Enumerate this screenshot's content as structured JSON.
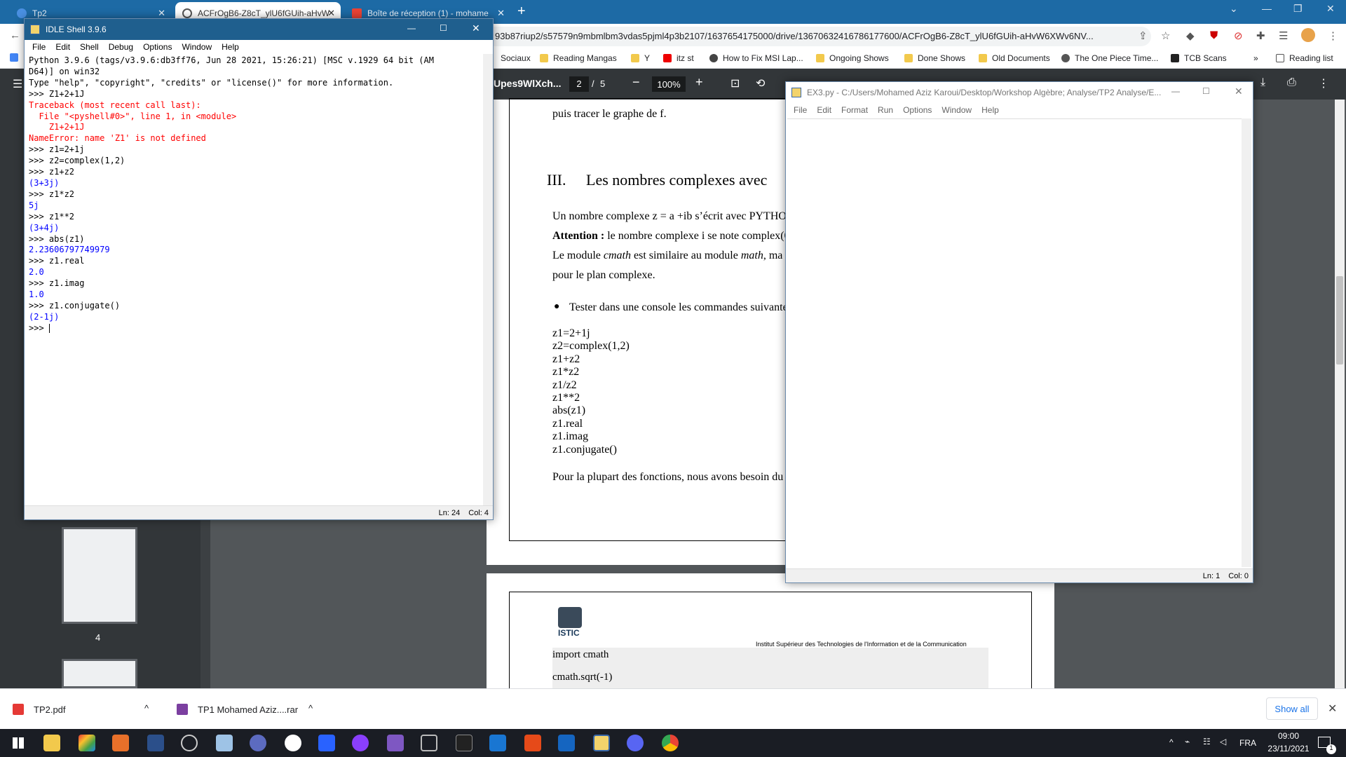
{
  "browser": {
    "tabs": [
      {
        "title": "Tp2"
      },
      {
        "title": "ACFrOgB6-Z8cT_ylU6fGUih-aHvW"
      },
      {
        "title": "Boîte de réception (1) - mohame"
      }
    ],
    "url": "93b87riup2/s57579n9mbmlbm3vdas5pjml4p3b2107/1637654175000/drive/13670632416786177600/ACFrOgB6-Z8cT_ylU6fGUih-aHvW6XWv6NV...",
    "bookmarks": [
      "Sociaux",
      "Reading Mangas",
      "Y",
      "itz st",
      "How to Fix MSI Lap...",
      "Ongoing Shows",
      "Done Shows",
      "Old Documents",
      "The One Piece Time...",
      "TCB Scans"
    ],
    "reading_list": "Reading list"
  },
  "pdf": {
    "title": "Upes9WlXch...",
    "page_current": "2",
    "page_sep": "/",
    "page_total": "5",
    "zoom": "100%",
    "thumb_number": "4",
    "text_top": "puis tracer le graphe de f.",
    "heading_num": "III.",
    "heading": "Les nombres complexes avec",
    "p1": "Un nombre complexe z = a +ib s’écrit avec PYTHO",
    "p2_bold": "Attention :",
    "p2": "le nombre complexe i se note complex(0",
    "p3a": "Le module ",
    "p3b": "cmath",
    "p3c": " est similaire au module ",
    "p3d": "math",
    "p3e": ", ma",
    "p4": "pour le plan complexe.",
    "bullet": "Tester dans une console les commandes suivante",
    "code": [
      "z1=2+1j",
      "z2=complex(1,2)",
      "z1+z2",
      "z1*z2",
      "z1/z2",
      "z1**2",
      "abs(z1)",
      "z1.real",
      "z1.imag",
      "z1.conjugate()"
    ],
    "p5": "Pour la plupart des fonctions, nous avons besoin du",
    "logo": "ISTIC",
    "institute": "Institut Supérieur des Technologies de l'Information et de la Communication",
    "code2": [
      "import cmath",
      "cmath.sqrt(-1)"
    ]
  },
  "idle_shell": {
    "title": "IDLE Shell 3.9.6",
    "menu": [
      "File",
      "Edit",
      "Shell",
      "Debug",
      "Options",
      "Window",
      "Help"
    ],
    "status_ln": "Ln: 24",
    "status_col": "Col: 4",
    "lines": [
      {
        "t": "Python 3.9.6 (tags/v3.9.6:db3ff76, Jun 28 2021, 15:26:21) [MSC v.1929 64 bit (AM",
        "c": "out"
      },
      {
        "t": "D64)] on win32",
        "c": "out"
      },
      {
        "t": "Type \"help\", \"copyright\", \"credits\" or \"license()\" for more information.",
        "c": "out"
      },
      {
        "t": ">>> Z1+2+1J",
        "c": "out"
      },
      {
        "t": "Traceback (most recent call last):",
        "c": "err"
      },
      {
        "t": "  File \"<pyshell#0>\", line 1, in <module>",
        "c": "err"
      },
      {
        "t": "    Z1+2+1J",
        "c": "err"
      },
      {
        "t": "NameError: name 'Z1' is not defined",
        "c": "err"
      },
      {
        "t": ">>> z1=2+1j",
        "c": "out"
      },
      {
        "t": ">>> z2=complex(1,2)",
        "c": "out"
      },
      {
        "t": ">>> z1+z2",
        "c": "out"
      },
      {
        "t": "(3+3j)",
        "c": "res"
      },
      {
        "t": ">>> z1*z2",
        "c": "out"
      },
      {
        "t": "5j",
        "c": "res"
      },
      {
        "t": ">>> z1**2",
        "c": "out"
      },
      {
        "t": "(3+4j)",
        "c": "res"
      },
      {
        "t": ">>> abs(z1)",
        "c": "out"
      },
      {
        "t": "2.23606797749979",
        "c": "res"
      },
      {
        "t": ">>> z1.real",
        "c": "out"
      },
      {
        "t": "2.0",
        "c": "res"
      },
      {
        "t": ">>> z1.imag",
        "c": "out"
      },
      {
        "t": "1.0",
        "c": "res"
      },
      {
        "t": ">>> z1.conjugate()",
        "c": "out"
      },
      {
        "t": "(2-1j)",
        "c": "res"
      },
      {
        "t": ">>> ",
        "c": "out"
      }
    ]
  },
  "idle_editor": {
    "title": "EX3.py - C:/Users/Mohamed Aziz Karoui/Desktop/Workshop Algèbre; Analyse/TP2 Analyse/E...",
    "menu": [
      "File",
      "Edit",
      "Format",
      "Run",
      "Options",
      "Window",
      "Help"
    ],
    "status_ln": "Ln: 1",
    "status_col": "Col: 0"
  },
  "downloads": {
    "items": [
      {
        "name": "TP2.pdf"
      },
      {
        "name": "TP1 Mohamed Aziz....rar"
      }
    ],
    "show_all": "Show all"
  },
  "taskbar": {
    "lang": "FRA",
    "time": "09:00",
    "date": "23/11/2021",
    "notif_count": "1"
  },
  "colors": {
    "tab_strip": "#1d6aa5",
    "pdf_toolbar": "#323639",
    "pdf_background": "#525659",
    "idle_error": "#ff0000",
    "idle_result": "#0000ff",
    "taskbar": "#1a1d24"
  }
}
